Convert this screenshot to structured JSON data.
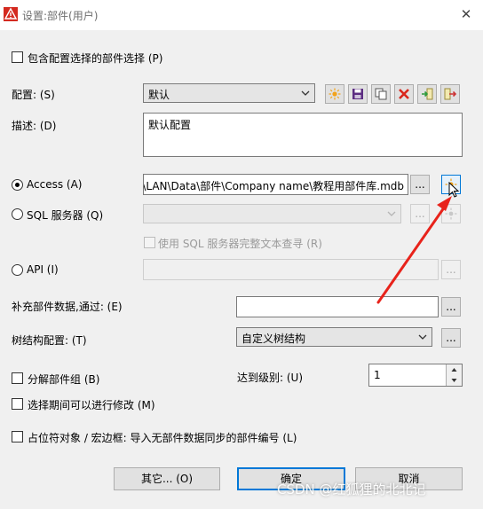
{
  "window": {
    "title": "设置:部件(用户)",
    "icon": "warning-triangle-icon",
    "close_glyph": "✕"
  },
  "include_config_checkbox": {
    "label": "包含配置选择的部件选择 (P)",
    "checked": false
  },
  "config": {
    "label": "配置: (S)",
    "value": "默认",
    "toolbar": [
      "new-icon",
      "save-icon",
      "copy-icon",
      "delete-icon",
      "import-icon",
      "export-icon"
    ]
  },
  "description": {
    "label": "描述: (D)",
    "value": "默认配置"
  },
  "access": {
    "label": "Access (A)",
    "selected": true,
    "path": "\\LAN\\Data\\部件\\Company name\\教程用部件库.mdb",
    "browse_label": "...",
    "new_icon": "sun-new-icon"
  },
  "sql": {
    "label": "SQL 服务器 (Q)",
    "selected": false,
    "browse_label": "...",
    "fulltext_label": "使用 SQL 服务器完整文本查寻 (R)"
  },
  "api": {
    "label": "API (I)",
    "selected": false,
    "browse_label": "..."
  },
  "supplement": {
    "label": "补充部件数据,通过: (E)",
    "value": "",
    "browse_label": "..."
  },
  "tree": {
    "label": "树结构配置: (T)",
    "value": "自定义树结构",
    "browse_label": "..."
  },
  "split_groups": {
    "label": "分解部件组 (B)",
    "checked": false
  },
  "level": {
    "label": "达到级别: (U)",
    "value": "1"
  },
  "modify_during": {
    "label": "选择期间可以进行修改 (M)",
    "checked": false
  },
  "placeholder_import": {
    "label": "占位符对象 / 宏边框: 导入无部件数据同步的部件编号 (L)",
    "checked": false
  },
  "buttons": {
    "other": "其它... (O)",
    "ok": "确定",
    "cancel": "取消"
  },
  "watermark": "CSDN @红狐狸的北北记",
  "colors": {
    "accent": "#0078d7",
    "annotation_arrow": "#e8231b",
    "delete_red": "#d9261c"
  }
}
